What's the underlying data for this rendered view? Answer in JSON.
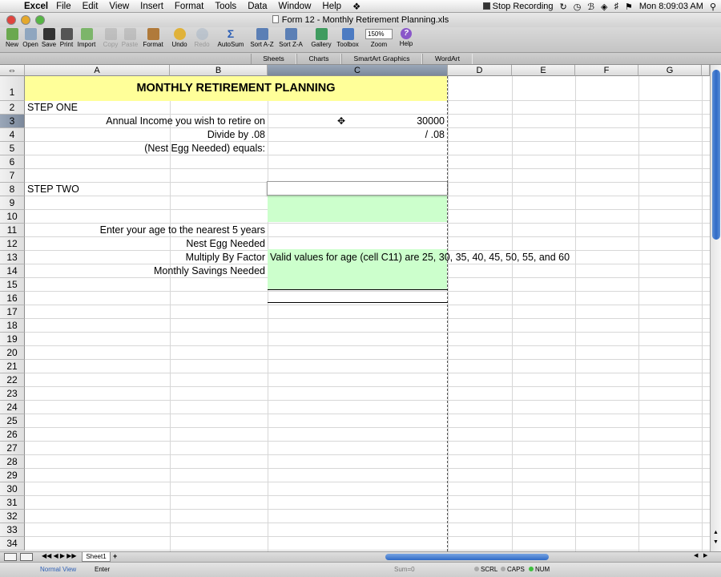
{
  "menubar": {
    "app": "Excel",
    "items": [
      "File",
      "Edit",
      "View",
      "Insert",
      "Format",
      "Tools",
      "Data",
      "Window",
      "Help"
    ],
    "stop_recording": "Stop Recording",
    "clock": "Mon 8:09:03 AM"
  },
  "window": {
    "title": "Form 12 - Monthly Retirement Planning.xls"
  },
  "toolbar": {
    "buttons": [
      "New",
      "Open",
      "Save",
      "Print",
      "Import",
      "Copy",
      "Paste",
      "Format",
      "Undo",
      "Redo",
      "AutoSum",
      "Sort A-Z",
      "Sort Z-A",
      "Gallery",
      "Toolbox",
      "Zoom",
      "Help"
    ],
    "zoom_value": "150%"
  },
  "ribbon": {
    "tabs": [
      "Sheets",
      "Charts",
      "SmartArt Graphics",
      "WordArt"
    ]
  },
  "sheet": {
    "columns": [
      "A",
      "B",
      "C",
      "D",
      "E",
      "F",
      "G"
    ],
    "rows": [
      "1",
      "2",
      "3",
      "4",
      "5",
      "6",
      "7",
      "8",
      "9",
      "10",
      "11",
      "12",
      "13",
      "14",
      "15",
      "16",
      "17",
      "18",
      "19",
      "20",
      "21",
      "22",
      "23",
      "24",
      "25",
      "26",
      "27",
      "28",
      "29",
      "30",
      "31",
      "32",
      "33",
      "34"
    ],
    "selected_column": "C",
    "selected_row": "3",
    "cells": {
      "title": "MONTHLY RETIREMENT PLANNING",
      "a2": "STEP ONE",
      "ab3": "Annual Income you wish to retire on",
      "c3": "30000",
      "ab4": "Divide by .08",
      "c4": "/ .08",
      "ab5": "(Nest Egg Needed) equals:",
      "a8": "STEP TWO",
      "ab11": "Enter your age to the nearest 5 years",
      "ab12": "Nest Egg Needed",
      "ab13": "Multiply By Factor",
      "c13": "Valid values for age (cell C11) are 25, 30, 35, 40, 45, 50, 55, and 60",
      "ab14": "Monthly Savings Needed"
    },
    "colors": {
      "title_fill": "#ffff99",
      "input_fill": "#ccffcc",
      "selected_header": "#8593a6"
    }
  },
  "sheet_tabs": [
    "Sheet1"
  ],
  "status": {
    "view": "Normal View",
    "mode": "Enter",
    "sum": "Sum=0",
    "scrl": "SCRL",
    "caps": "CAPS",
    "num": "NUM"
  }
}
